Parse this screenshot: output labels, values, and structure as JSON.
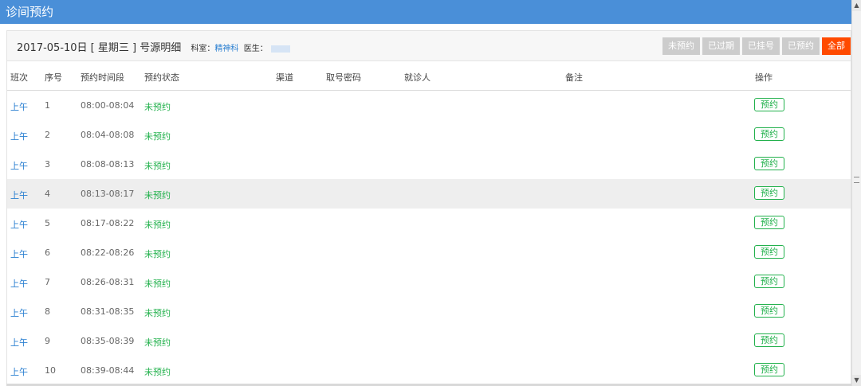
{
  "window": {
    "title": "诊间预约"
  },
  "header": {
    "date_line": "2017-05-10日 [ 星期三 ] 号源明细",
    "dept_label": "科室：",
    "dept_value": "精神科",
    "doctor_label": "医生："
  },
  "filters": [
    {
      "label": "未预约",
      "active": false
    },
    {
      "label": "已过期",
      "active": false
    },
    {
      "label": "已挂号",
      "active": false
    },
    {
      "label": "已预约",
      "active": false
    },
    {
      "label": "全部",
      "active": true
    }
  ],
  "colors": {
    "title_bar": "#4a8fd8",
    "active_filter": "#ff4a00",
    "status_green": "#22b14c",
    "link_blue": "#2a7fd1"
  },
  "table": {
    "columns": {
      "shift": "班次",
      "seq": "序号",
      "time": "预约时间段",
      "status": "预约状态",
      "channel": "渠道",
      "pwd": "取号密码",
      "patient": "就诊人",
      "note": "备注",
      "op": "操作"
    },
    "rows": [
      {
        "shift": "上午",
        "seq": "1",
        "time": "08:00-08:04",
        "status": "未预约",
        "action": "预约"
      },
      {
        "shift": "上午",
        "seq": "2",
        "time": "08:04-08:08",
        "status": "未预约",
        "action": "预约"
      },
      {
        "shift": "上午",
        "seq": "3",
        "time": "08:08-08:13",
        "status": "未预约",
        "action": "预约"
      },
      {
        "shift": "上午",
        "seq": "4",
        "time": "08:13-08:17",
        "status": "未预约",
        "action": "预约"
      },
      {
        "shift": "上午",
        "seq": "5",
        "time": "08:17-08:22",
        "status": "未预约",
        "action": "预约"
      },
      {
        "shift": "上午",
        "seq": "6",
        "time": "08:22-08:26",
        "status": "未预约",
        "action": "预约"
      },
      {
        "shift": "上午",
        "seq": "7",
        "time": "08:26-08:31",
        "status": "未预约",
        "action": "预约"
      },
      {
        "shift": "上午",
        "seq": "8",
        "time": "08:31-08:35",
        "status": "未预约",
        "action": "预约"
      },
      {
        "shift": "上午",
        "seq": "9",
        "time": "08:35-08:39",
        "status": "未预约",
        "action": "预约"
      },
      {
        "shift": "上午",
        "seq": "10",
        "time": "08:39-08:44",
        "status": "未预约",
        "action": "预约"
      }
    ]
  }
}
